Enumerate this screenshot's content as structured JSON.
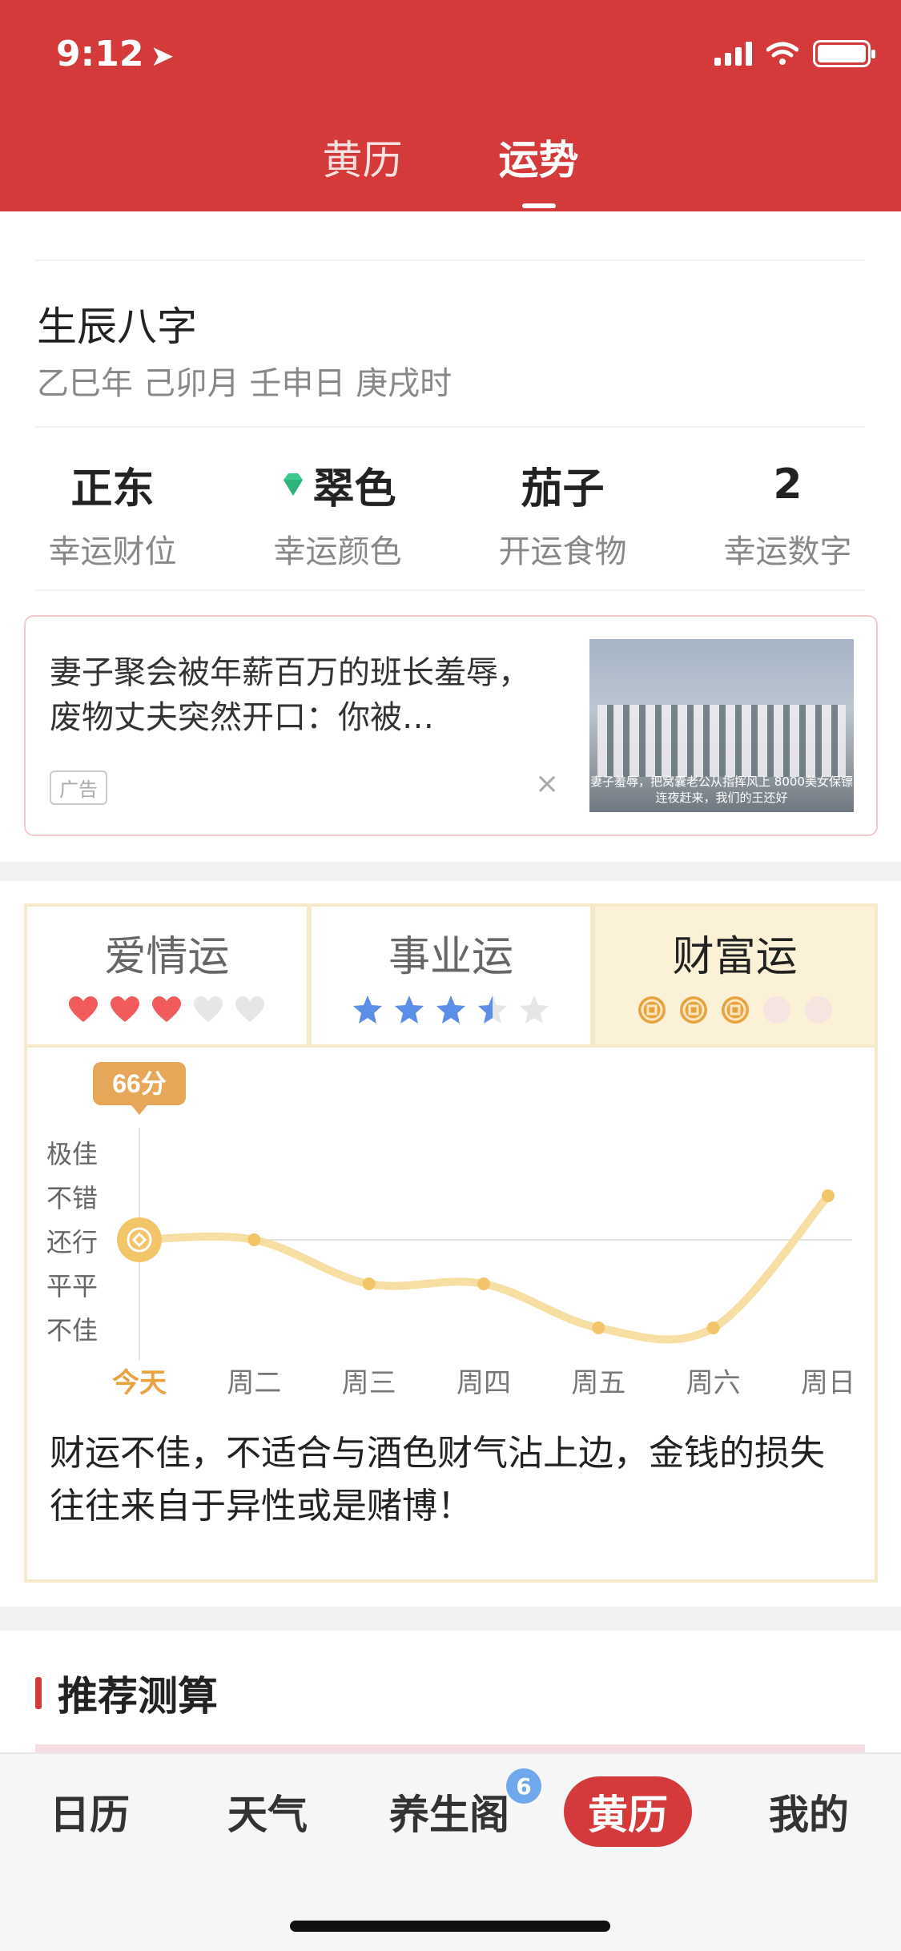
{
  "status": {
    "time": "9:12"
  },
  "header": {
    "tabs": [
      {
        "label": "黄历",
        "active": false
      },
      {
        "label": "运势",
        "active": true
      }
    ]
  },
  "bazi": {
    "title": "生辰八字",
    "value": "乙巳年 己卯月 壬申日 庚戌时"
  },
  "lucky": [
    {
      "value": "正东",
      "label": "幸运财位"
    },
    {
      "value": "翠色",
      "label": "幸运颜色",
      "icon": "gem-icon",
      "icon_color": "#3cc98f"
    },
    {
      "value": "茄子",
      "label": "开运食物"
    },
    {
      "value": "2",
      "label": "幸运数字"
    }
  ],
  "ad": {
    "title": "妻子聚会被年薪百万的班长羞辱，废物丈夫突然开口：你被…",
    "tag": "广告",
    "close": "×",
    "image_caption": "妻子羞辱，把窝囊老公从指挥风上 8000美女保镖连夜赶来，我们的王还好"
  },
  "fortune": {
    "tabs": [
      {
        "label": "爱情运",
        "icon": "heart-icon",
        "rating": 3,
        "max": 5,
        "color": "#f25b5b",
        "active": false
      },
      {
        "label": "事业运",
        "icon": "star-icon",
        "rating": 3.5,
        "max": 5,
        "color": "#5b8ee6",
        "active": false
      },
      {
        "label": "财富运",
        "icon": "coin-icon",
        "rating": 3,
        "max": 5,
        "color": "#e8a23e",
        "active": true
      }
    ],
    "score_label": "66分",
    "y_levels": [
      "极佳",
      "不错",
      "还行",
      "平平",
      "不佳"
    ],
    "description": "财运不佳，不适合与酒色财气沾上边，金钱的损失往往来自于异性或是赌博！"
  },
  "chart_data": {
    "type": "line",
    "categories": [
      "今天",
      "周二",
      "周三",
      "周四",
      "周五",
      "周六",
      "周日"
    ],
    "values": [
      3,
      3,
      2,
      2,
      1,
      1,
      4
    ],
    "y_levels": [
      "极佳",
      "不错",
      "还行",
      "平平",
      "不佳"
    ],
    "ylim": [
      1,
      5
    ],
    "highlight": {
      "label": "66分",
      "index": 0
    },
    "line_color": "#f7dfa3",
    "point_color": "#f2c568"
  },
  "recommend": {
    "title": "推荐测算"
  },
  "nav": {
    "items": [
      {
        "label": "日历",
        "active": false
      },
      {
        "label": "天气",
        "active": false
      },
      {
        "label": "养生阁",
        "active": false,
        "badge": "6"
      },
      {
        "label": "黄历",
        "active": true
      },
      {
        "label": "我的",
        "active": false
      }
    ]
  },
  "colors": {
    "brand": "#d43a3a",
    "accent": "#e8a23e"
  }
}
